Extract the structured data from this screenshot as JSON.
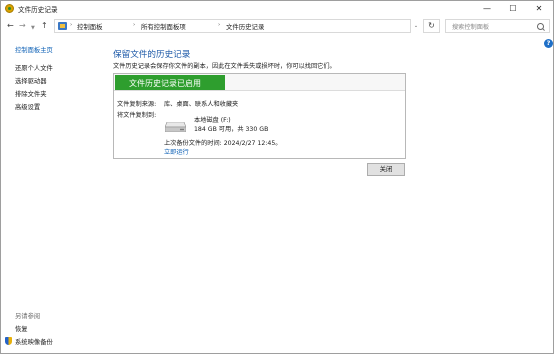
{
  "window": {
    "title": "文件历史记录",
    "controls": {
      "minimize": "—",
      "maximize": "☐",
      "close": "✕"
    }
  },
  "address_bar": {
    "breadcrumbs": [
      "控制面板",
      "所有控制面板项",
      "文件历史记录"
    ],
    "search_placeholder": "搜索控制面板"
  },
  "help": {
    "label": "?"
  },
  "sidebar": {
    "home": "控制面板主页",
    "links": [
      "还原个人文件",
      "选择驱动器",
      "排除文件夹",
      "高级设置"
    ],
    "see_also_title": "另请参阅",
    "see_also": [
      "恢复",
      "系统映像备份"
    ]
  },
  "main": {
    "title": "保留文件的历史记录",
    "description": "文件历史记录会保存你文件的副本，因此在文件丢失或损坏时，你可以找回它们。",
    "status": "文件历史记录已启用",
    "copy_from_label": "文件复制来源:",
    "copy_from_value": "库、桌面、联系人和收藏夹",
    "copy_to_label": "将文件复制到:",
    "drive_name": "本地磁盘 (F:)",
    "drive_space": "184 GB 可用，共 330 GB",
    "last_backup": "上次备份文件的时间: 2024/2/27 12:45。",
    "run_now": "立即运行",
    "close_button": "关闭"
  },
  "colors": {
    "accent": "#1e5aa8",
    "status_green": "#2e9e2e",
    "link": "#0b5fb5"
  }
}
